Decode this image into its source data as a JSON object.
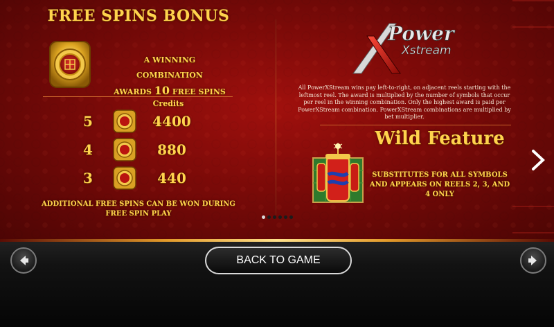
{
  "free_spins": {
    "title": "FREE SPINS BONUS",
    "desc_line1": "A WINNING COMBINATION",
    "desc_awards": "AWARDS",
    "desc_count": "10",
    "desc_suffix": "FREE SPINS",
    "credits_header": "Credits",
    "paytable": [
      {
        "count": "5",
        "credits": "4400"
      },
      {
        "count": "4",
        "credits": "880"
      },
      {
        "count": "3",
        "credits": "440"
      }
    ],
    "note": "ADDITIONAL FREE SPINS CAN BE WON DURING FREE SPIN PLAY"
  },
  "power_xstream": {
    "logo_power": "Power",
    "logo_xstream": "Xstream",
    "description": "All PowerXStream wins pay left-to-right, on adjacent reels starting with the leftmost reel. The award is multiplied by the number of symbols that occur per reel in the winning combination. Only the highest award is paid per PowerXStream combination. PowerXStream combinations are multiplied by bet multiplier."
  },
  "wild_feature": {
    "title": "Wild Feature",
    "description": "SUBSTITUTES FOR ALL SYMBOLS AND APPEARS ON REELS 2, 3, AND 4 ONLY"
  },
  "pagination": {
    "total": 6,
    "current": 1
  },
  "footer": {
    "back_label": "BACK TO GAME"
  },
  "icons": {
    "bonus_symbol": "gold-medallion-icon",
    "wild_symbol": "firecracker-icon",
    "next_page": "chevron-right-icon",
    "prev_button": "arrow-left-icon",
    "next_button": "arrow-right-icon"
  },
  "colors": {
    "gold": "#ffd34d",
    "background": "#7a0a08",
    "accent_line": "#c8642a"
  }
}
